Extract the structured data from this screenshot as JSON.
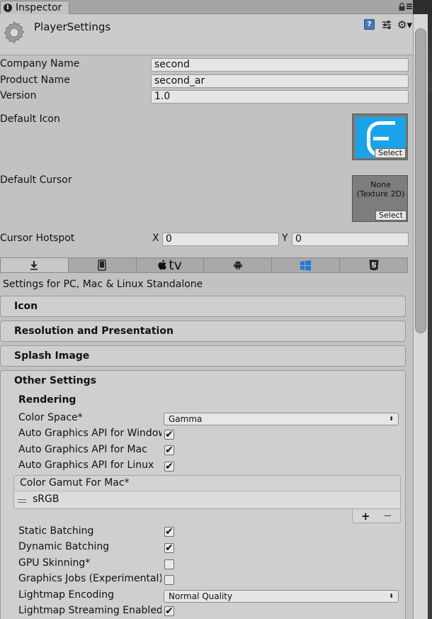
{
  "tab": {
    "label": "Inspector"
  },
  "header": {
    "title": "PlayerSettings"
  },
  "fields": {
    "company_label": "Company Name",
    "company_value": "second",
    "product_label": "Product Name",
    "product_value": "second_ar",
    "version_label": "Version",
    "version_value": "1.0",
    "default_icon_label": "Default Icon",
    "default_cursor_label": "Default Cursor",
    "cursor_none_text": "None\n(Texture 2D)",
    "select_label": "Select",
    "hotspot_label": "Cursor Hotspot",
    "hotspot_x_label": "X",
    "hotspot_x_value": "0",
    "hotspot_y_label": "Y",
    "hotspot_y_value": "0"
  },
  "platform_tabs": {
    "tv_label": "tv",
    "active": "standalone"
  },
  "platform_title": "Settings for PC, Mac & Linux Standalone",
  "sections": {
    "icon": "Icon",
    "resolution": "Resolution and Presentation",
    "splash": "Splash Image",
    "other": "Other Settings"
  },
  "rendering": {
    "title": "Rendering",
    "color_space_label": "Color Space*",
    "color_space_value": "Gamma",
    "auto_windows_label": "Auto Graphics API  for Windows",
    "auto_mac_label": "Auto Graphics API  for Mac",
    "auto_linux_label": "Auto Graphics API  for Linux",
    "gamut_title": "Color Gamut For Mac*",
    "gamut_item": "sRGB",
    "gamut_add": "+",
    "gamut_remove": "−",
    "static_batching_label": "Static Batching",
    "dynamic_batching_label": "Dynamic Batching",
    "gpu_skinning_label": "GPU Skinning*",
    "graphics_jobs_label": "Graphics Jobs (Experimental)",
    "lightmap_encoding_label": "Lightmap Encoding",
    "lightmap_encoding_value": "Normal Quality",
    "lightmap_streaming_label": "Lightmap Streaming Enabled"
  },
  "checks": {
    "auto_windows": true,
    "auto_mac": true,
    "auto_linux": true,
    "static_batching": true,
    "dynamic_batching": true,
    "gpu_skinning": false,
    "graphics_jobs": false,
    "lightmap_streaming": true
  },
  "colors": {
    "icon_bg": "#1aa3e8",
    "help_blue": "#4a78b8"
  }
}
